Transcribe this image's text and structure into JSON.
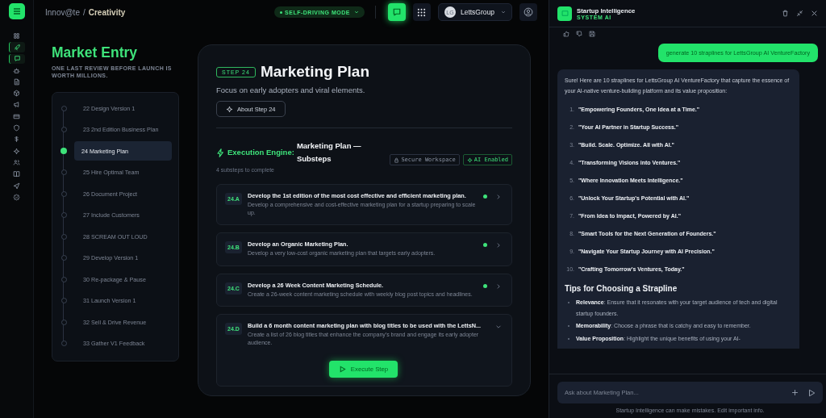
{
  "rail": {
    "items": [
      {
        "kind": "grid",
        "active": false
      },
      {
        "kind": "rocket",
        "active": true
      },
      {
        "kind": "chat",
        "active": true
      },
      {
        "kind": "robot",
        "active": false
      },
      {
        "kind": "document",
        "active": false
      },
      {
        "kind": "cube",
        "active": false
      },
      {
        "kind": "megaphone",
        "active": false
      },
      {
        "kind": "card",
        "active": false
      },
      {
        "kind": "shield",
        "active": false
      },
      {
        "kind": "dollar",
        "active": false
      },
      {
        "kind": "sparkle",
        "active": false
      },
      {
        "kind": "users",
        "active": false
      },
      {
        "kind": "book",
        "active": false
      },
      {
        "kind": "send",
        "active": false
      },
      {
        "kind": "badge",
        "active": false
      }
    ]
  },
  "header": {
    "breadcrumb": {
      "parent": "Innov@te",
      "separator": "/",
      "current": "Creativity"
    },
    "mode": {
      "label": "SELF-DRIVING MODE",
      "on": true
    },
    "chat_open": true,
    "account": {
      "initials": "LG",
      "name": "LettsGroup"
    }
  },
  "phase": {
    "title": "Market Entry",
    "subtitle": "ONE LAST REVIEW BEFORE LAUNCH IS WORTH MILLIONS."
  },
  "steps": [
    {
      "label": "22 Design Version 1",
      "selected": false
    },
    {
      "label": "23 2nd Edition Business Plan",
      "selected": false
    },
    {
      "label": "24 Marketing Plan",
      "selected": true
    },
    {
      "label": "25 Hire Optimal Team",
      "selected": false
    },
    {
      "label": "26 Document Project",
      "selected": false
    },
    {
      "label": "27 Include Customers",
      "selected": false
    },
    {
      "label": "28 SCREAM OUT LOUD",
      "selected": false
    },
    {
      "label": "29 Develop Version 1",
      "selected": false
    },
    {
      "label": "30 Re-package & Pause",
      "selected": false
    },
    {
      "label": "31 Launch Version 1",
      "selected": false
    },
    {
      "label": "32 Sell & Drive Revenue",
      "selected": false
    },
    {
      "label": "33 Gather V1 Feedback",
      "selected": false
    }
  ],
  "plan": {
    "badge": "STEP 24",
    "title": "Marketing Plan",
    "focus": "Focus on early adopters and viral elements.",
    "about_button": "About Step 24",
    "section": {
      "accent": "Execution Engine:",
      "title": "Marketing Plan — Substeps",
      "count": "4 substeps to complete",
      "tags": [
        {
          "kind": "lock",
          "label": "Secure Workspace"
        },
        {
          "kind": "ai",
          "label": "AI Enabled"
        }
      ]
    },
    "substeps": [
      {
        "code": "24.A",
        "title": "Develop the 1st edition of the most cost effective and efficient marketing plan.",
        "description": "Develop a comprehensive and cost-effective marketing plan for a startup preparing to scale up.",
        "done": true,
        "expanded": false
      },
      {
        "code": "24.B",
        "title": "Develop an Organic Marketing Plan.",
        "description": "Develop a very low-cost organic marketing plan that targets early adopters.",
        "done": true,
        "expanded": false
      },
      {
        "code": "24.C",
        "title": "Develop a 26 Week Content Marketing Schedule.",
        "description": "Create a 26-week content marketing schedule with weekly blog post topics and headlines.",
        "done": true,
        "expanded": false
      },
      {
        "code": "24.D",
        "title": "Build a 6 month content marketing plan with blog titles to be used with the LettsN...",
        "description": "Create a list of 26 blog titles that enhance the company's brand and engage its early adopter audience.",
        "done": false,
        "expanded": true
      }
    ],
    "execute_button": "Execute Step"
  },
  "chat": {
    "title": "Startup Intelligence",
    "subtitle": "SYSTEM AI",
    "user_message": "generate 10 straplines for LettsGroup AI VentureFactory",
    "reply": {
      "intro": "Sure! Here are 10 straplines for LettsGroup AI VentureFactory that capture the essence of your AI-native venture-building platform and its value proposition:",
      "items": [
        {
          "number": "1.",
          "text": "\"Empowering Founders, One Idea at a Time.\""
        },
        {
          "number": "2.",
          "text": "\"Your AI Partner in Startup Success.\""
        },
        {
          "number": "3.",
          "text": "\"Build. Scale. Optimize. All with AI.\""
        },
        {
          "number": "4.",
          "text": "\"Transforming Visions into Ventures.\""
        },
        {
          "number": "5.",
          "text": "\"Where Innovation Meets Intelligence.\""
        },
        {
          "number": "6.",
          "text": "\"Unlock Your Startup's Potential with AI.\""
        },
        {
          "number": "7.",
          "text": "\"From Idea to Impact, Powered by AI.\""
        },
        {
          "number": "8.",
          "text": "\"Smart Tools for the Next Generation of Founders.\""
        },
        {
          "number": "9.",
          "text": "\"Navigate Your Startup Journey with AI Precision.\""
        },
        {
          "number": "10.",
          "text": "\"Crafting Tomorrow's Ventures, Today.\""
        }
      ],
      "tips_heading": "Tips for Choosing a Strapline",
      "tips": [
        "**Relevance**: Ensure that it resonates with your target audience of tech and digital startup founders.",
        "**Memorability**: Choose a phrase that is catchy and easy to remember.",
        "**Value Proposition**: Highlight the unique benefits of using your AI-"
      ]
    },
    "input": {
      "placeholder": "Ask about Marketing Plan..."
    },
    "disclaimer": "Startup Intelligence can make mistakes. Edit important info."
  }
}
